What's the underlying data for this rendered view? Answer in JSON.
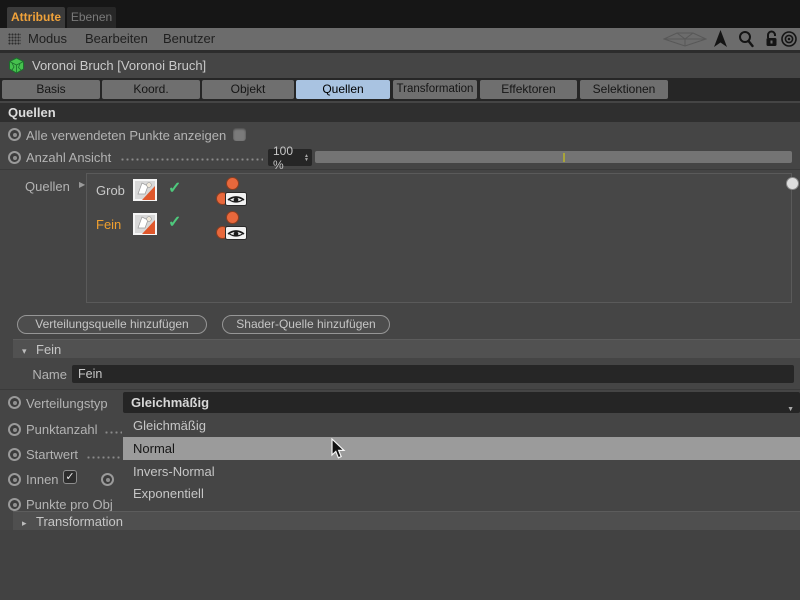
{
  "panel_tabs": {
    "attribute": "Attribute",
    "ebenen": "Ebenen"
  },
  "menu": {
    "modus": "Modus",
    "bearbeiten": "Bearbeiten",
    "benutzer": "Benutzer"
  },
  "object": {
    "title": "Voronoi Bruch [Voronoi Bruch]"
  },
  "object_tabs": {
    "labels": [
      "Basis",
      "Koord.",
      "Objekt",
      "Quellen",
      "Transformation",
      "Effektoren",
      "Selektionen"
    ],
    "active": "Quellen"
  },
  "sources": {
    "header": "Quellen",
    "show_points_label": "Alle verwendeten Punkte anzeigen",
    "show_points_checked": false,
    "view_count_label": "Anzahl Ansicht",
    "view_count_value": "100 %",
    "list_label": "Quellen",
    "items": [
      {
        "name": "Grob",
        "selected": false
      },
      {
        "name": "Fein",
        "selected": true
      }
    ],
    "add_distribution_button": "Verteilungsquelle hinzufügen",
    "add_shader_button": "Shader-Quelle hinzufügen"
  },
  "fein": {
    "header": "Fein",
    "name_label": "Name",
    "name_value": "Fein",
    "distribution_label": "Verteilungstyp",
    "distribution_value": "Gleichmäßig",
    "point_count_label": "Punktanzahl",
    "seed_label": "Startwert",
    "inner_label": "Innen",
    "inner_checked": true,
    "points_per_obj_label": "Punkte pro Obj",
    "dropdown_options": [
      "Gleichmäßig",
      "Normal",
      "Invers-Normal",
      "Exponentiell"
    ],
    "highlighted_option": "Normal"
  },
  "transformation": {
    "header": "Transformation"
  },
  "icons": {
    "check": "✓",
    "collapse": "▾",
    "expand": "▸",
    "list_arrow": "▶",
    "combo_arrow": "▼",
    "up": "▲",
    "down": "▼"
  },
  "colors": {
    "accent_orange": "#f0a23a",
    "selected_tab_blue": "#a9c3e1",
    "source_orange": "#e8683c",
    "check_green": "#4ec97c",
    "highlight_gray": "#9b9b9b"
  }
}
